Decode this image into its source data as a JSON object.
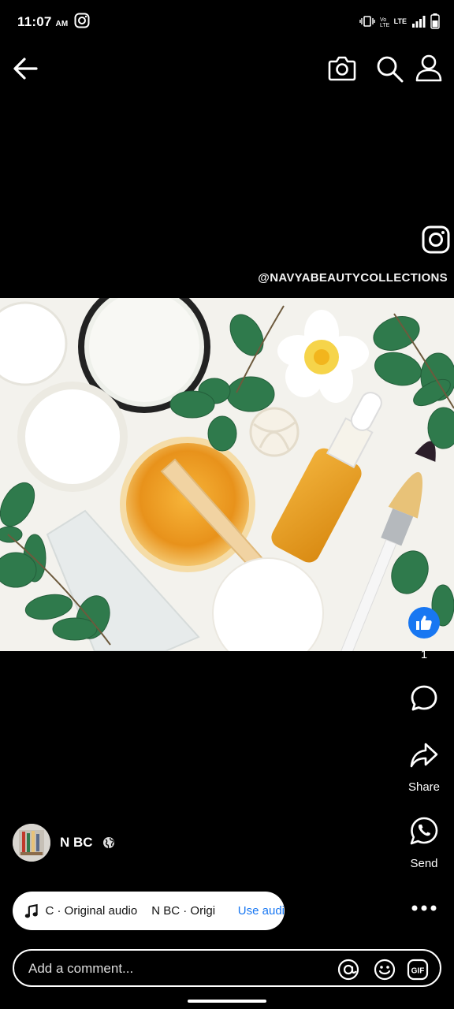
{
  "status_bar": {
    "time": "11:07",
    "ampm": "AM",
    "network_label": "LTE"
  },
  "top_bar": {
    "back_icon": "arrow-left-icon",
    "camera_icon": "camera-icon",
    "search_icon": "search-icon",
    "profile_icon": "profile-icon"
  },
  "watermark": {
    "handle": "@NAVYABEAUTYCOLLECTIONS"
  },
  "actions": {
    "like_count": "1",
    "share_label": "Share",
    "send_label": "Send"
  },
  "author": {
    "name": "N BC"
  },
  "audio": {
    "segment1": "C · Original audio",
    "segment2": "N BC · Origi",
    "use_audio_label": "Use audi"
  },
  "comment": {
    "placeholder": "Add a comment..."
  },
  "colors": {
    "accent": "#1877f2",
    "background": "#000000"
  }
}
